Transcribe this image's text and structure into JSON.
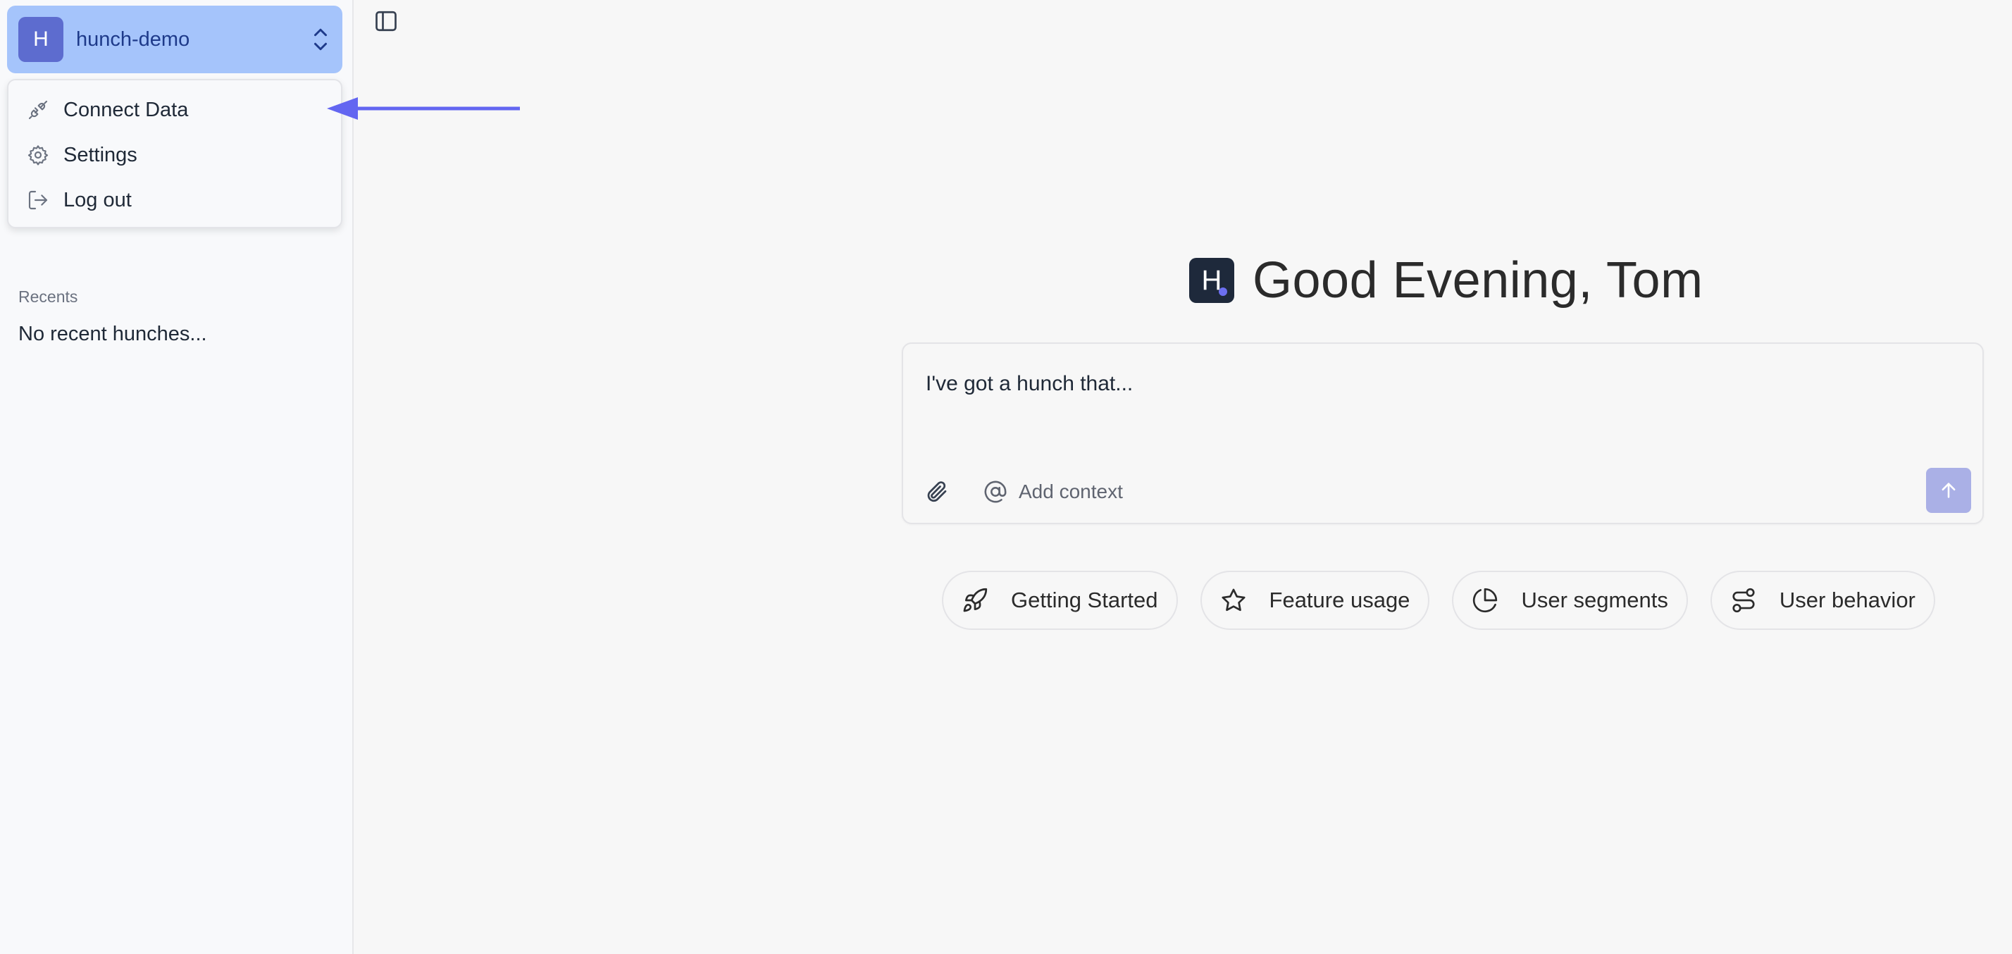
{
  "workspace": {
    "avatar_letter": "H",
    "name": "hunch-demo"
  },
  "menu": {
    "items": [
      {
        "label": "Connect Data",
        "icon": "plug-icon"
      },
      {
        "label": "Settings",
        "icon": "gear-icon"
      },
      {
        "label": "Log out",
        "icon": "logout-icon"
      }
    ]
  },
  "sidebar": {
    "recents_title": "Recents",
    "recents_empty": "No recent hunches..."
  },
  "main": {
    "logo_letter": "H",
    "greeting": "Good Evening, Tom",
    "composer": {
      "placeholder": "I've got a hunch that...",
      "add_context_label": "Add context"
    },
    "suggestions": [
      {
        "label": "Getting Started",
        "icon": "rocket-icon"
      },
      {
        "label": "Feature usage",
        "icon": "star-icon"
      },
      {
        "label": "User segments",
        "icon": "pie-chart-icon"
      },
      {
        "label": "User behavior",
        "icon": "route-icon"
      }
    ]
  },
  "colors": {
    "accent": "#5d6ccf",
    "workspace_bg": "#a5c4fb",
    "send_button": "#aab0e6",
    "annotation_arrow": "#6366f1"
  }
}
